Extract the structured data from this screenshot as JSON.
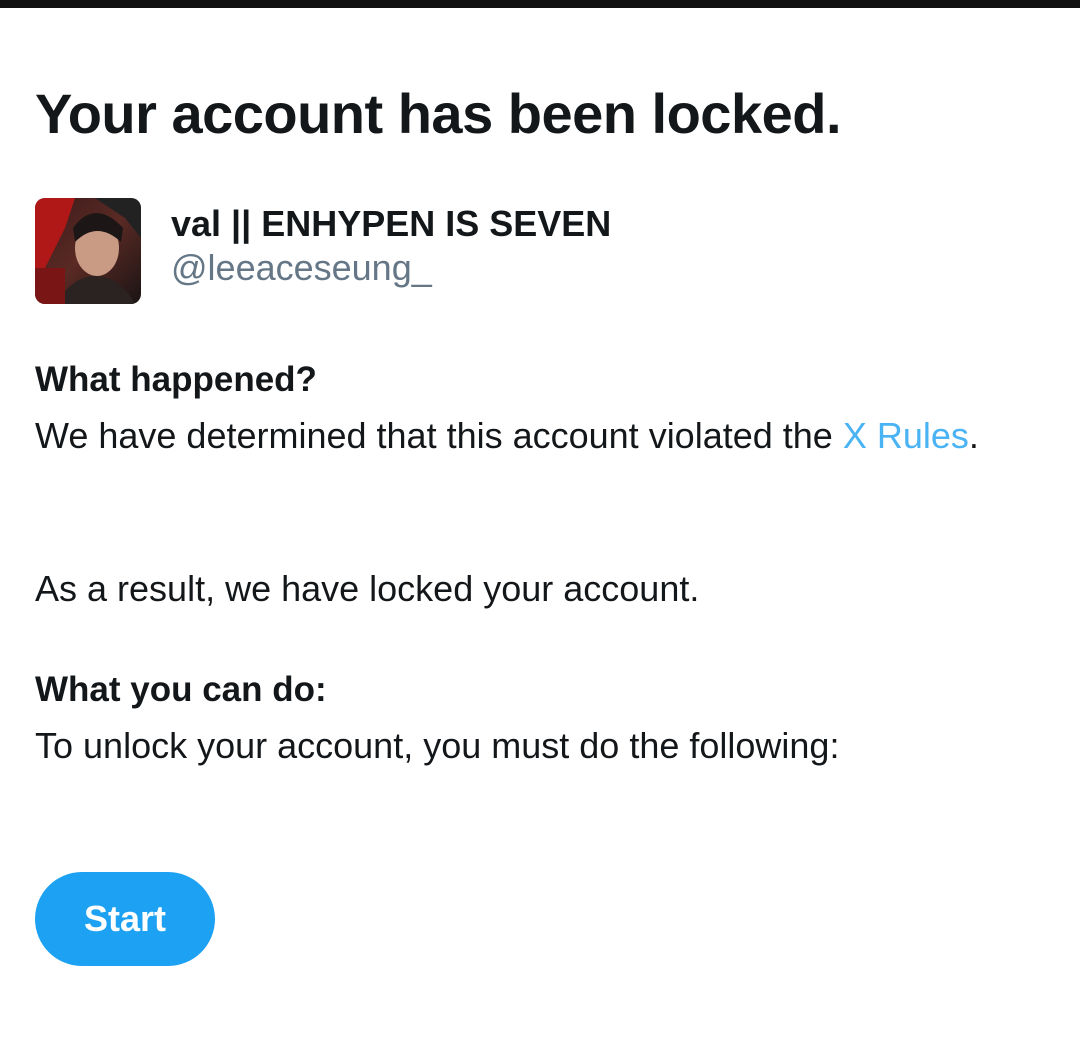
{
  "page": {
    "title": "Your account has been locked."
  },
  "account": {
    "display_name": "val || ENHYPEN IS SEVEN",
    "handle": "@leeaceseung_",
    "avatar_icon": "profile-photo"
  },
  "what_happened": {
    "heading": "What happened?",
    "text_before_link": "We have determined that this account violated the ",
    "link_text": "X Rules",
    "text_after_link": ".",
    "result_text": "As a result, we have locked your account."
  },
  "what_you_can_do": {
    "heading": "What you can do:",
    "text": "To unlock your account, you must do the following:"
  },
  "actions": {
    "start_label": "Start"
  },
  "colors": {
    "accent": "#1da1f2",
    "text_primary": "#14171a",
    "text_secondary": "#657786"
  }
}
